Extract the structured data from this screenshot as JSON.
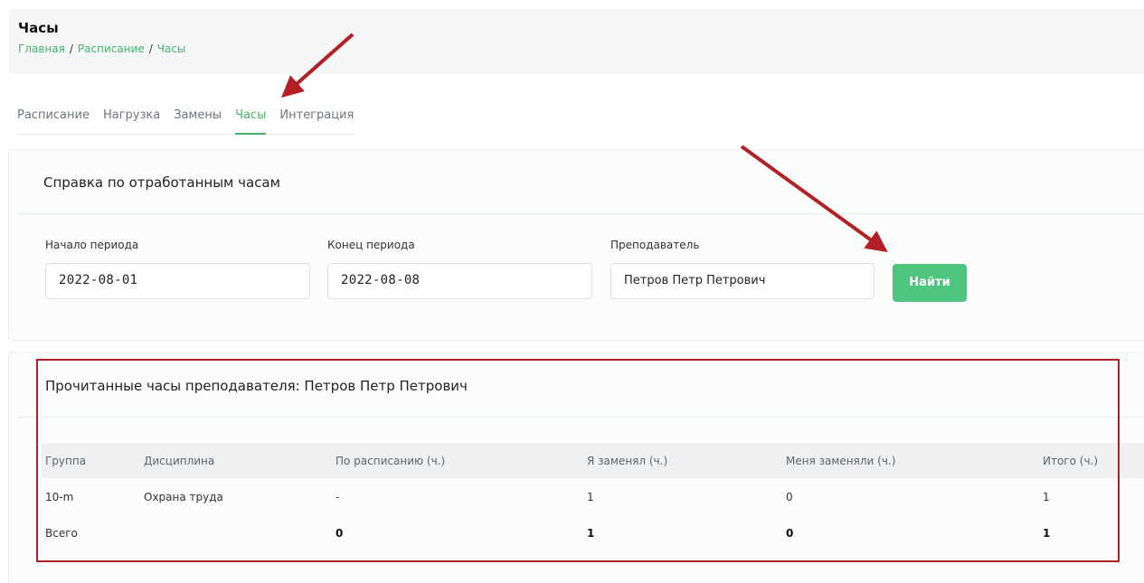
{
  "header": {
    "title": "Часы",
    "breadcrumb": [
      "Главная",
      "Расписание",
      "Часы"
    ],
    "separator": "/"
  },
  "tabs": [
    {
      "label": "Расписание",
      "active": false
    },
    {
      "label": "Нагрузка",
      "active": false
    },
    {
      "label": "Замены",
      "active": false
    },
    {
      "label": "Часы",
      "active": true
    },
    {
      "label": "Интеграция",
      "active": false
    }
  ],
  "report_form": {
    "title": "Справка по отработанным часам",
    "period_start": {
      "label": "Начало периода",
      "value": "2022-08-01"
    },
    "period_end": {
      "label": "Конец периода",
      "value": "2022-08-08"
    },
    "teacher": {
      "label": "Преподаватель",
      "value": "Петров Петр Петрович"
    },
    "find_label": "Найти"
  },
  "results": {
    "title": "Прочитанные часы преподавателя: Петров Петр Петрович",
    "columns": [
      "Группа",
      "Дисциплина",
      "По расписанию (ч.)",
      "Я заменял (ч.)",
      "Меня заменяли (ч.)",
      "Итого (ч.)"
    ],
    "rows": [
      {
        "group": "10-m",
        "discipline": "Охрана труда",
        "scheduled": "-",
        "i_replaced": "1",
        "replaced_me": "0",
        "total": "1"
      }
    ],
    "totals": {
      "label": "Всего",
      "scheduled": "0",
      "i_replaced": "1",
      "replaced_me": "0",
      "total": "1"
    }
  },
  "colors": {
    "accent": "#46b36d",
    "button": "#4fc67f",
    "annotation": "#b21f24"
  }
}
